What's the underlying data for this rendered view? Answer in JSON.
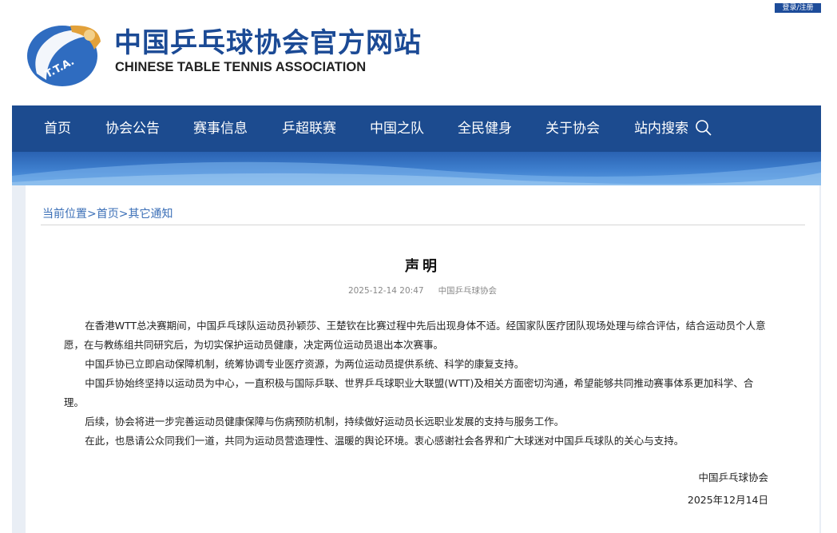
{
  "header": {
    "top_link": "登录/注册",
    "logo_text": "T.T.A.",
    "site_title": "中国乒乓球协会官方网站",
    "site_subtitle": "CHINESE TABLE TENNIS ASSOCIATION"
  },
  "nav": {
    "items": [
      "首页",
      "协会公告",
      "赛事信息",
      "乒超联赛",
      "中国之队",
      "全民健身",
      "关于协会",
      "站内搜索"
    ],
    "search_icon": "search-icon"
  },
  "breadcrumb": "当前位置>首页>其它通知",
  "article": {
    "title": "声明",
    "date": "2025-12-14 20:47",
    "source": "中国乒乓球协会",
    "paragraphs": [
      "在香港WTT总决赛期间，中国乒乓球队运动员孙颖莎、王楚钦在比赛过程中先后出现身体不适。经国家队医疗团队现场处理与综合评估，结合运动员个人意愿，在与教练组共同研究后，为切实保护运动员健康，决定两位运动员退出本次赛事。",
      "中国乒协已立即启动保障机制，统筹协调专业医疗资源，为两位运动员提供系统、科学的康复支持。",
      "中国乒协始终坚持以运动员为中心，一直积极与国际乒联、世界乒乓球职业大联盟(WTT)及相关方面密切沟通，希望能够共同推动赛事体系更加科学、合理。",
      "后续，协会将进一步完善运动员健康保障与伤病预防机制，持续做好运动员长远职业发展的支持与服务工作。",
      "在此，也恳请公众同我们一道，共同为运动员营造理性、温暖的舆论环境。衷心感谢社会各界和广大球迷对中国乒乓球队的关心与支持。"
    ],
    "signature": "中国乒乓球协会",
    "sign_date": "2025年12月14日"
  },
  "colors": {
    "brand_blue": "#1c4b8f",
    "link_blue": "#3b6fb7"
  }
}
